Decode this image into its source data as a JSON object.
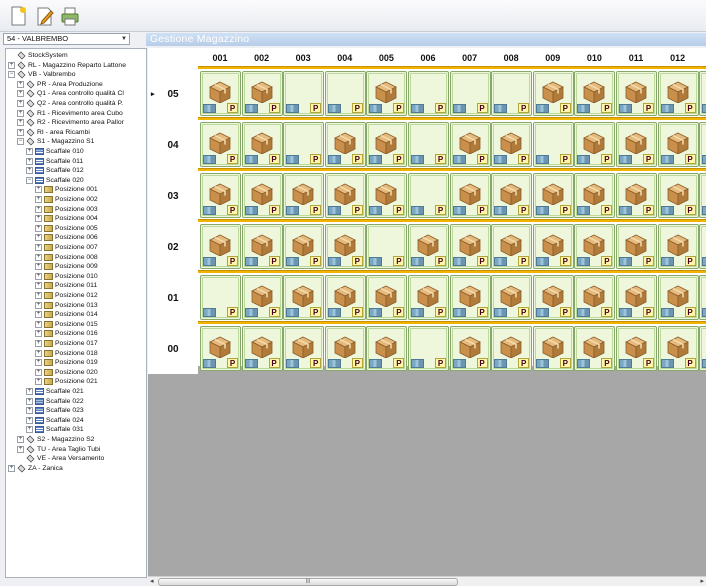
{
  "toolbar": {
    "buttons": [
      {
        "icon": "new-document-icon"
      },
      {
        "icon": "edit-document-icon"
      },
      {
        "icon": "print-icon"
      }
    ]
  },
  "warehouse_selector": {
    "value": "54 - VALBREMBO"
  },
  "panel_title": "Gestione Magazzino",
  "tree": [
    {
      "label": "StockSystem",
      "level": 0,
      "exp": "none",
      "icon": "site"
    },
    {
      "label": "RL - Magazzino Reparto Lattone",
      "level": 0,
      "exp": "plus",
      "icon": "site"
    },
    {
      "label": "VB - Valbrembo",
      "level": 0,
      "exp": "minus",
      "icon": "site"
    },
    {
      "label": "PR - Area Produzione",
      "level": 1,
      "exp": "plus",
      "icon": "site"
    },
    {
      "label": "Q1 - Area controllo qualità Cl",
      "level": 1,
      "exp": "plus",
      "icon": "site"
    },
    {
      "label": "Q2 - Area controllo qualità P.",
      "level": 1,
      "exp": "plus",
      "icon": "site"
    },
    {
      "label": "R1 - Ricevimento area Cubo",
      "level": 1,
      "exp": "plus",
      "icon": "site"
    },
    {
      "label": "R2 - Ricevimento area Pallor",
      "level": 1,
      "exp": "plus",
      "icon": "site"
    },
    {
      "label": "RI - area Ricambi",
      "level": 1,
      "exp": "plus",
      "icon": "site"
    },
    {
      "label": "S1 - Magazzino S1",
      "level": 1,
      "exp": "minus",
      "icon": "site"
    },
    {
      "label": "Scaffale 010",
      "level": 2,
      "exp": "plus",
      "icon": "shelf"
    },
    {
      "label": "Scaffale 011",
      "level": 2,
      "exp": "plus",
      "icon": "shelf"
    },
    {
      "label": "Scaffale 012",
      "level": 2,
      "exp": "plus",
      "icon": "shelf"
    },
    {
      "label": "Scaffale 020",
      "level": 2,
      "exp": "minus",
      "icon": "shelf"
    },
    {
      "label": "Posizione 001",
      "level": 3,
      "exp": "plus",
      "icon": "pos"
    },
    {
      "label": "Posizione 002",
      "level": 3,
      "exp": "plus",
      "icon": "pos"
    },
    {
      "label": "Posizione 003",
      "level": 3,
      "exp": "plus",
      "icon": "pos"
    },
    {
      "label": "Posizione 004",
      "level": 3,
      "exp": "plus",
      "icon": "pos"
    },
    {
      "label": "Posizione 005",
      "level": 3,
      "exp": "plus",
      "icon": "pos"
    },
    {
      "label": "Posizione 006",
      "level": 3,
      "exp": "plus",
      "icon": "pos"
    },
    {
      "label": "Posizione 007",
      "level": 3,
      "exp": "plus",
      "icon": "pos"
    },
    {
      "label": "Posizione 008",
      "level": 3,
      "exp": "plus",
      "icon": "pos"
    },
    {
      "label": "Posizione 009",
      "level": 3,
      "exp": "plus",
      "icon": "pos"
    },
    {
      "label": "Posizione 010",
      "level": 3,
      "exp": "plus",
      "icon": "pos"
    },
    {
      "label": "Posizione 011",
      "level": 3,
      "exp": "plus",
      "icon": "pos"
    },
    {
      "label": "Posizione 012",
      "level": 3,
      "exp": "plus",
      "icon": "pos"
    },
    {
      "label": "Posizione 013",
      "level": 3,
      "exp": "plus",
      "icon": "pos"
    },
    {
      "label": "Posizione 014",
      "level": 3,
      "exp": "plus",
      "icon": "pos"
    },
    {
      "label": "Posizione 015",
      "level": 3,
      "exp": "plus",
      "icon": "pos"
    },
    {
      "label": "Posizione 016",
      "level": 3,
      "exp": "plus",
      "icon": "pos"
    },
    {
      "label": "Posizione 017",
      "level": 3,
      "exp": "plus",
      "icon": "pos"
    },
    {
      "label": "Posizione 018",
      "level": 3,
      "exp": "plus",
      "icon": "pos"
    },
    {
      "label": "Posizione 019",
      "level": 3,
      "exp": "plus",
      "icon": "pos"
    },
    {
      "label": "Posizione 020",
      "level": 3,
      "exp": "plus",
      "icon": "pos"
    },
    {
      "label": "Posizione 021",
      "level": 3,
      "exp": "plus",
      "icon": "pos"
    },
    {
      "label": "Scaffale 021",
      "level": 2,
      "exp": "plus",
      "icon": "shelf"
    },
    {
      "label": "Scaffale 022",
      "level": 2,
      "exp": "plus",
      "icon": "shelf"
    },
    {
      "label": "Scaffale 023",
      "level": 2,
      "exp": "plus",
      "icon": "shelf"
    },
    {
      "label": "Scaffale 024",
      "level": 2,
      "exp": "plus",
      "icon": "shelf"
    },
    {
      "label": "Scaffale 031",
      "level": 2,
      "exp": "plus",
      "icon": "shelf"
    },
    {
      "label": "S2 - Magazzino S2",
      "level": 1,
      "exp": "plus",
      "icon": "site"
    },
    {
      "label": "TU - Area Taglio Tubi",
      "level": 1,
      "exp": "plus",
      "icon": "site"
    },
    {
      "label": "VE - Area Versamento",
      "level": 1,
      "exp": "none",
      "icon": "site"
    },
    {
      "label": "ZA - Zanica",
      "level": 0,
      "exp": "plus",
      "icon": "site"
    }
  ],
  "rack": {
    "columns": [
      "001",
      "002",
      "003",
      "004",
      "005",
      "006",
      "007",
      "008",
      "009",
      "010",
      "011",
      "012",
      "0"
    ],
    "rows": [
      {
        "label": "05",
        "current": true,
        "boxes": [
          1,
          1,
          0,
          0,
          1,
          0,
          0,
          0,
          1,
          1,
          1,
          1,
          1
        ]
      },
      {
        "label": "04",
        "current": false,
        "boxes": [
          1,
          1,
          0,
          1,
          1,
          0,
          1,
          1,
          0,
          1,
          1,
          1,
          1
        ]
      },
      {
        "label": "03",
        "current": false,
        "boxes": [
          1,
          1,
          1,
          1,
          1,
          0,
          1,
          1,
          1,
          1,
          1,
          1,
          1
        ]
      },
      {
        "label": "02",
        "current": false,
        "boxes": [
          1,
          1,
          1,
          1,
          0,
          1,
          1,
          1,
          1,
          1,
          1,
          1,
          1
        ]
      },
      {
        "label": "01",
        "current": false,
        "boxes": [
          0,
          1,
          1,
          1,
          1,
          1,
          1,
          1,
          1,
          1,
          1,
          1,
          1
        ]
      },
      {
        "label": "00",
        "current": false,
        "boxes": [
          1,
          1,
          1,
          1,
          1,
          0,
          1,
          1,
          1,
          1,
          1,
          1,
          1
        ]
      }
    ],
    "tag": "P",
    "current_marker": "▸"
  },
  "scroll": {
    "thumb_label": "III"
  }
}
